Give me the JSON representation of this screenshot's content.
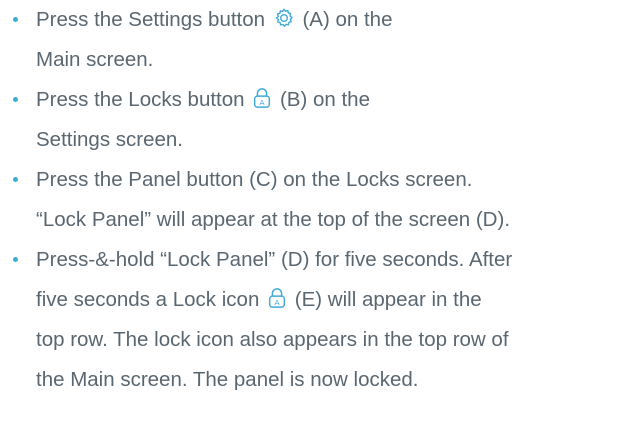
{
  "colors": {
    "text": "#5a6770",
    "accent": "#3fa9d9"
  },
  "steps": [
    {
      "icon": "settings-gear-icon",
      "line1_before": "Press the Settings button",
      "line1_after": "(A) on the",
      "line2": "Main screen."
    },
    {
      "icon": "lock-icon",
      "line1_before": "Press the Locks button",
      "line1_after": "(B) on the",
      "line2": "Settings screen."
    },
    {
      "line1": "Press the Panel button (C) on the Locks screen.",
      "line2": "“Lock Panel” will appear at the top of the screen (D)."
    },
    {
      "icon": "lock-icon",
      "line1": "Press-&-hold “Lock Panel” (D) for five seconds. After",
      "line2_before": "five seconds a Lock icon",
      "line2_after": "(E) will appear in the",
      "line3": "top row. The lock icon also appears in the top row of",
      "line4": "the Main screen. The panel is now locked."
    }
  ]
}
